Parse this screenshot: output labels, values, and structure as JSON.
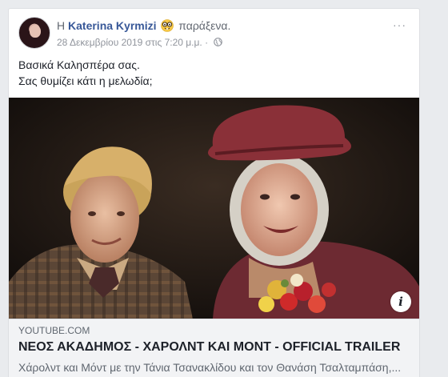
{
  "post": {
    "prefix": "Η",
    "author": "Katerina Kyrmizi",
    "feeling_icon": "nerd-face-emoji",
    "feeling": "παράξενα.",
    "timestamp": "28 Δεκεμβρίου 2019 στις 7:20 μ.μ.",
    "separator": "·",
    "privacy_icon": "globe-icon",
    "text_line1": "Βασικά Καλησπέρα σας.",
    "text_line2": "Σας θυμίζει κάτι η μελωδία;"
  },
  "link_preview": {
    "domain": "YOUTUBE.COM",
    "title": "ΝΕΟΣ ΑΚΑΔΗΜΟΣ - ΧΑΡΟΛΝΤ ΚΑΙ ΜΟΝΤ - OFFICIAL TRAILER",
    "description": "Χάρολντ και Μόντ με την Τάνια Τσανακλίδου και τον Θανάση Τσαλταμπάση,...",
    "info_label": "i"
  },
  "colors": {
    "page_bg": "#e9ebee",
    "author_link": "#385898",
    "text": "#1d2129",
    "muted": "#90949c"
  }
}
